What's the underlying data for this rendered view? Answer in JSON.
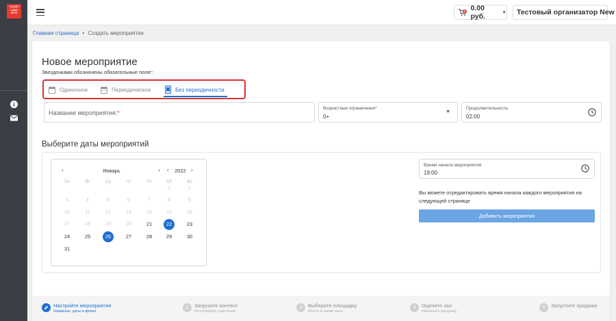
{
  "logo_text": "TICKET LAND INTO",
  "header": {
    "cart_amount": "0.00 руб.",
    "organizer": "Тестовый организатор New"
  },
  "breadcrumb": {
    "home": "Главная страница",
    "separator": "•",
    "current": "Создать мероприятие"
  },
  "form": {
    "title": "Новое мероприятие",
    "required_note": "Звездочками обозначены обязательные поля",
    "required_star": "*",
    "tabs": [
      {
        "label": "Одиночное",
        "active": false
      },
      {
        "label": "Периодическое",
        "active": false
      },
      {
        "label": "Без периодичности",
        "active": true
      }
    ],
    "name_field": {
      "placeholder": "Название мероприятия:",
      "star": "*"
    },
    "age_field": {
      "label": "Возрастные ограничения",
      "star": "*",
      "value": "0+"
    },
    "duration_field": {
      "label": "Продолжительность",
      "value": "02:00"
    }
  },
  "dates_section": {
    "title": "Выберите даты мероприятий",
    "calendar": {
      "month": "Январь",
      "year": "2022",
      "weekdays": [
        "Пн",
        "Вт",
        "Ср",
        "Чт",
        "Пт",
        "Сб",
        "Вс"
      ],
      "weeks": [
        [
          "",
          "",
          "",
          "",
          "",
          "1",
          "2"
        ],
        [
          "3",
          "4",
          "5",
          "6",
          "7",
          "8",
          "9"
        ],
        [
          "10",
          "11",
          "12",
          "13",
          "14",
          "15",
          "16"
        ],
        [
          "17",
          "18",
          "19",
          "20",
          "21",
          "22",
          "23"
        ],
        [
          "24",
          "25",
          "26",
          "27",
          "28",
          "29",
          "30"
        ],
        [
          "31",
          "",
          "",
          "",
          "",
          "",
          ""
        ]
      ],
      "disabled_until": 20,
      "selected": [
        "22",
        "26"
      ]
    },
    "start_time": {
      "label": "Время начала мероприятия",
      "value": "19:00"
    },
    "hint": "Вы можете отредактировать время начала каждого мероприятия на следующей странице",
    "add_button": "Добавить мероприятия"
  },
  "steps": [
    {
      "num": "1",
      "title": "Настройте мероприятие",
      "sub": "Название, даты и время",
      "active": true
    },
    {
      "num": "2",
      "title": "Загрузите контент",
      "sub": "Фотографии, участники",
      "active": false
    },
    {
      "num": "3",
      "title": "Выберите площадку",
      "sub": "Место и схема зала",
      "active": false
    },
    {
      "num": "4",
      "title": "Оцените зал",
      "sub": "Назначьте расценку",
      "active": false
    },
    {
      "num": "5",
      "title": "Запустите продажи",
      "sub": "",
      "active": false
    }
  ],
  "colors": {
    "accent": "#1f6fd1",
    "highlight_border": "#d8312d",
    "button": "#6ba5e4",
    "sidebar": "#3b3f45",
    "logo": "#e8392d"
  }
}
